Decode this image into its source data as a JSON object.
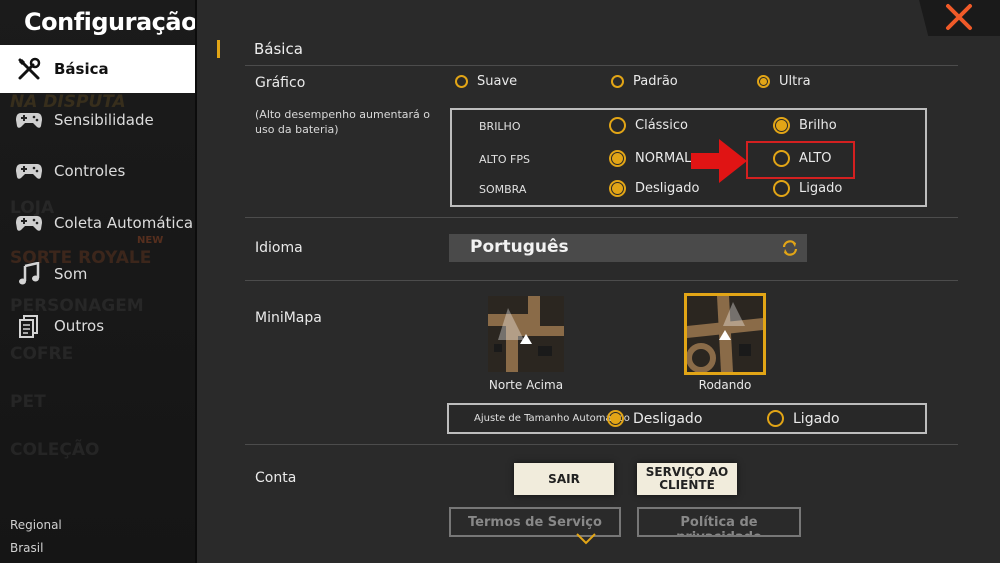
{
  "sidebar": {
    "title": "Configuração",
    "background_labels": [
      "NA DISPUTA",
      "LOJA",
      "SORTE ROYALE",
      "PERSONAGEM",
      "COFRE",
      "PET",
      "COLEÇÃO"
    ],
    "background_badge": "NEW",
    "items": [
      {
        "label": "Básica",
        "icon": "tools-icon",
        "active": true
      },
      {
        "label": "Sensibilidade",
        "icon": "gamepad-icon",
        "active": false
      },
      {
        "label": "Controles",
        "icon": "gamepad-icon",
        "active": false
      },
      {
        "label": "Coleta Automática",
        "icon": "gamepad-icon",
        "active": false
      },
      {
        "label": "Som",
        "icon": "music-note-icon",
        "active": false
      },
      {
        "label": "Outros",
        "icon": "document-icon",
        "active": false
      }
    ],
    "region_label": "Regional",
    "region_value": "Brasil"
  },
  "main": {
    "section_title": "Básica",
    "graphics": {
      "label": "Gráfico",
      "note": "(Alto desempenho aumentará o uso da bateria)",
      "options": [
        {
          "label": "Suave",
          "selected": false
        },
        {
          "label": "Padrão",
          "selected": false
        },
        {
          "label": "Ultra",
          "selected": true
        }
      ],
      "rows": [
        {
          "name": "BRILHO",
          "a": {
            "label": "Clássico",
            "selected": false
          },
          "b": {
            "label": "Brilho",
            "selected": true
          }
        },
        {
          "name": "ALTO FPS",
          "a": {
            "label": "NORMAL",
            "selected": true
          },
          "b": {
            "label": "ALTO",
            "selected": false
          }
        },
        {
          "name": "SOMBRA",
          "a": {
            "label": "Desligado",
            "selected": true
          },
          "b": {
            "label": "Ligado",
            "selected": false
          }
        }
      ]
    },
    "language": {
      "label": "Idioma",
      "value": "Português"
    },
    "minimap": {
      "label": "MiniMapa",
      "options": [
        {
          "label": "Norte Acima",
          "selected": false
        },
        {
          "label": "Rodando",
          "selected": true
        }
      ],
      "auto_size_label": "Ajuste de Tamanho Automático",
      "auto_size_options": [
        {
          "label": "Desligado",
          "selected": true
        },
        {
          "label": "Ligado",
          "selected": false
        }
      ]
    },
    "account": {
      "label": "Conta",
      "logout_button": "SAIR",
      "support_button": "SERVIÇO AO CLIENTE",
      "terms_button": "Termos de Serviço",
      "privacy_button": "Política de privacidade"
    }
  },
  "colors": {
    "accent": "#e2a516",
    "highlight": "#d42020",
    "close": "#f05a28"
  },
  "icons": {
    "close": "close-icon",
    "refresh": "refresh-icon",
    "scroll": "chevron-down-icon",
    "annotation": "red-arrow-icon"
  }
}
